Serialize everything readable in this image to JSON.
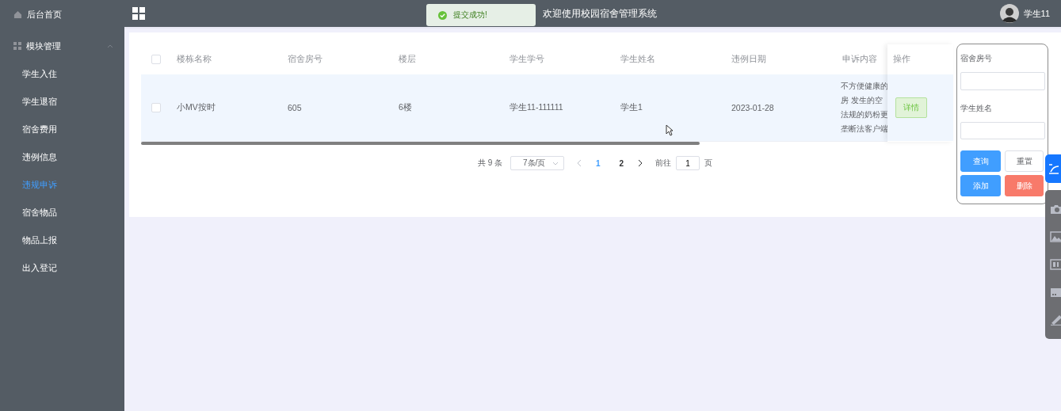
{
  "header": {
    "title": "欢迎使用校园宿舍管理系统",
    "user": "学生11"
  },
  "toast": {
    "message": "提交成功!"
  },
  "sidebar": {
    "items": [
      {
        "label": "后台首页",
        "kind": "link"
      },
      {
        "label": "模块管理",
        "kind": "group",
        "expanded": true,
        "children": [
          {
            "label": "学生入住",
            "selected": false
          },
          {
            "label": "学生退宿",
            "selected": false
          },
          {
            "label": "宿舍费用",
            "selected": false
          },
          {
            "label": "违例信息",
            "selected": false
          },
          {
            "label": "违规申诉",
            "selected": true
          },
          {
            "label": "宿舍物品",
            "selected": false
          },
          {
            "label": "物品上报",
            "selected": false
          },
          {
            "label": "出入登记",
            "selected": false
          }
        ]
      }
    ]
  },
  "table": {
    "select_all": {
      "checked": false
    },
    "columns": [
      {
        "label": "楼栋名称"
      },
      {
        "label": "宿舍房号"
      },
      {
        "label": "楼层"
      },
      {
        "label": "学生学号"
      },
      {
        "label": "学生姓名"
      },
      {
        "label": "违例日期"
      },
      {
        "label": "申诉内容"
      }
    ],
    "action_column": "操作",
    "rows": [
      {
        "checked": false,
        "cells": [
          "小MV按时",
          "605",
          "6楼",
          "学生11-111111",
          "学生1",
          "2023-01-28"
        ],
        "content_lines": [
          "不方便健康的",
          "房 发生的空",
          "法规的奶粉更",
          "垄断法客户端"
        ],
        "action": "详情"
      }
    ]
  },
  "pagination": {
    "total": "共 9 条",
    "page_size": "7条/页",
    "pages": [
      {
        "label": "1",
        "selected": true
      },
      {
        "label": "2",
        "selected": false
      }
    ],
    "goto_label": "前往",
    "goto_value": "1",
    "goto_suffix": "页"
  },
  "search_panel": {
    "fields": [
      {
        "label": "宿舍房号"
      },
      {
        "label": "学生姓名"
      }
    ],
    "buttons": [
      {
        "label": "查询",
        "kind": "primary"
      },
      {
        "label": "重置",
        "kind": "default"
      },
      {
        "label": "添加",
        "kind": "primary"
      },
      {
        "label": "删除",
        "kind": "danger"
      }
    ]
  }
}
